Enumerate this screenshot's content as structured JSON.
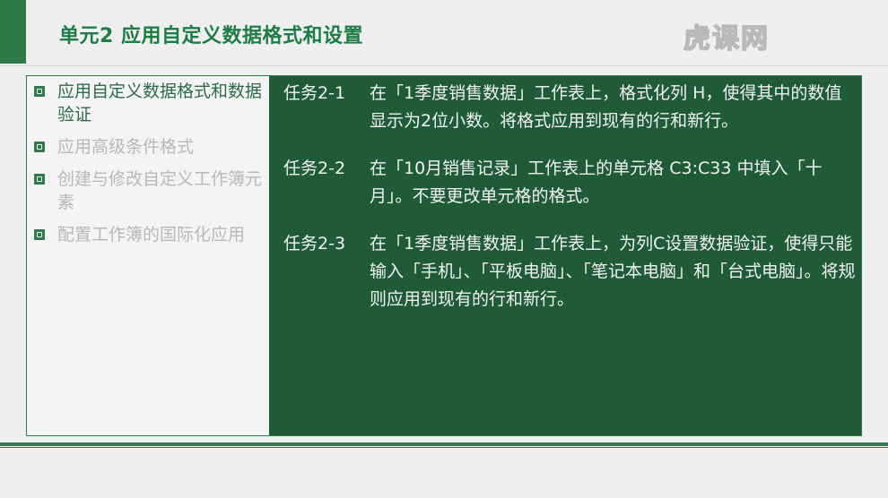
{
  "header": {
    "title": "单元2 应用自定义数据格式和设置",
    "watermark": "虎课网"
  },
  "sidebar": {
    "items": [
      {
        "label": "应用自定义数据格式和数据验证",
        "active": true
      },
      {
        "label": "应用高级条件格式",
        "active": false
      },
      {
        "label": "创建与修改自定义工作簿元素",
        "active": false
      },
      {
        "label": "配置工作簿的国际化应用",
        "active": false
      }
    ]
  },
  "tasks": [
    {
      "id": "任务2-1",
      "text": "在「1季度销售数据」工作表上，格式化列 H，使得其中的数值显示为2位小数。将格式应用到现有的行和新行。"
    },
    {
      "id": "任务2-2",
      "text": "在「10月销售记录」工作表上的单元格 C3:C33 中填入「十月」。不要更改单元格的格式。"
    },
    {
      "id": "任务2-3",
      "text": "在「1季度销售数据」工作表上，为列C设置数据验证，使得只能输入「手机」、「平板电脑」、「笔记本电脑」和「台式电脑」。将规则应用到现有的行和新行。"
    }
  ],
  "colors": {
    "accent": "#2e7b49",
    "panel": "#1e5b36",
    "active_text": "#2d6a4b",
    "inactive_text": "#b8b8b8"
  }
}
